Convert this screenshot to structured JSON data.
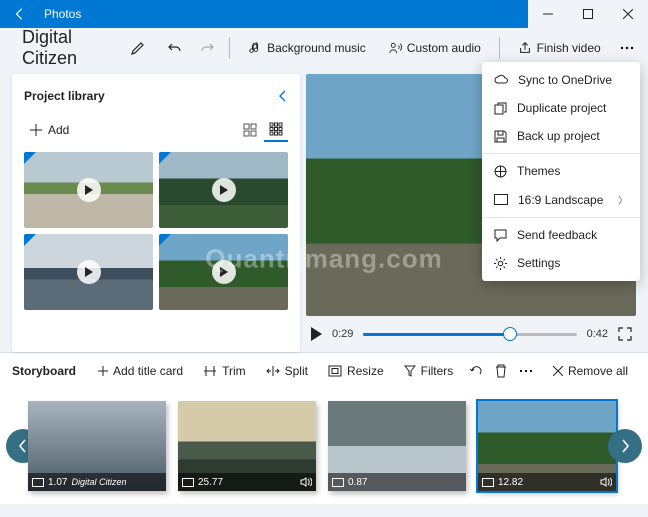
{
  "titlebar": {
    "title": "Photos"
  },
  "project": {
    "name": "Digital Citizen"
  },
  "toolbar": {
    "bg_music": "Background music",
    "custom_audio": "Custom audio",
    "finish": "Finish video"
  },
  "library": {
    "title": "Project library",
    "add": "Add"
  },
  "preview": {
    "current": "0:29",
    "duration": "0:42",
    "progress_pct": 69
  },
  "storyboard": {
    "title": "Storyboard",
    "add_title_card": "Add title card",
    "trim": "Trim",
    "split": "Split",
    "resize": "Resize",
    "filters": "Filters",
    "remove_all": "Remove all",
    "clips": [
      {
        "dur": "1.07",
        "text": "Digital Citizen"
      },
      {
        "dur": "25.77"
      },
      {
        "dur": "0.87"
      },
      {
        "dur": "12.82"
      }
    ]
  },
  "menu": {
    "sync": "Sync to OneDrive",
    "duplicate": "Duplicate project",
    "backup": "Back up project",
    "themes": "Themes",
    "aspect": "16:9 Landscape",
    "feedback": "Send feedback",
    "settings": "Settings"
  },
  "watermark": "Quantrimang.com"
}
